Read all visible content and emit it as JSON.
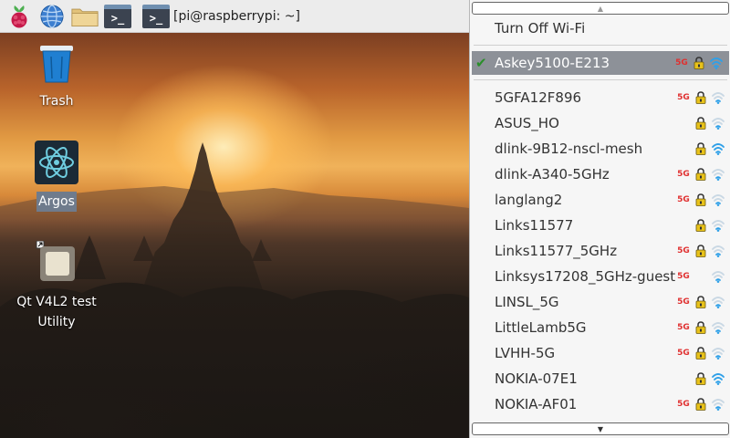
{
  "taskbar": {
    "window_title": "[pi@raspberrypi: ~]",
    "terminal_glyph": ">_",
    "icons": [
      "raspberry-menu-icon",
      "web-browser-icon",
      "file-manager-icon",
      "terminal-icon"
    ]
  },
  "desktop": {
    "icons": [
      {
        "label": "Trash"
      },
      {
        "label": "Argos"
      },
      {
        "label": "Qt V4L2 test Utility"
      }
    ]
  },
  "wifi_menu": {
    "turn_off_label": "Turn Off Wi-Fi",
    "connected": {
      "name": "Askey5100-E213",
      "badge": "5G",
      "secured": true,
      "signal": 3
    },
    "networks": [
      {
        "name": "5GFA12F896",
        "badge": "5G",
        "secured": true,
        "signal": 1
      },
      {
        "name": "ASUS_HO",
        "badge": "",
        "secured": true,
        "signal": 1
      },
      {
        "name": "dlink-9B12-nscl-mesh",
        "badge": "",
        "secured": true,
        "signal": 3
      },
      {
        "name": "dlink-A340-5GHz",
        "badge": "5G",
        "secured": true,
        "signal": 1
      },
      {
        "name": "langlang2",
        "badge": "5G",
        "secured": true,
        "signal": 1
      },
      {
        "name": "Links11577",
        "badge": "",
        "secured": true,
        "signal": 1
      },
      {
        "name": "Links11577_5GHz",
        "badge": "5G",
        "secured": true,
        "signal": 1
      },
      {
        "name": "Linksys17208_5GHz-guest",
        "badge": "5G",
        "secured": false,
        "signal": 1
      },
      {
        "name": "LINSL_5G",
        "badge": "5G",
        "secured": true,
        "signal": 1
      },
      {
        "name": "LittleLamb5G",
        "badge": "5G",
        "secured": true,
        "signal": 1
      },
      {
        "name": "LVHH-5G",
        "badge": "5G",
        "secured": true,
        "signal": 1
      },
      {
        "name": "NOKIA-07E1",
        "badge": "",
        "secured": true,
        "signal": 3
      },
      {
        "name": "NOKIA-AF01",
        "badge": "5G",
        "secured": true,
        "signal": 1
      }
    ],
    "colors": {
      "badge": "#e03030",
      "signal": "#2fa0e8",
      "lock": "#e8c21a",
      "active_bg": "#8d9198"
    }
  }
}
